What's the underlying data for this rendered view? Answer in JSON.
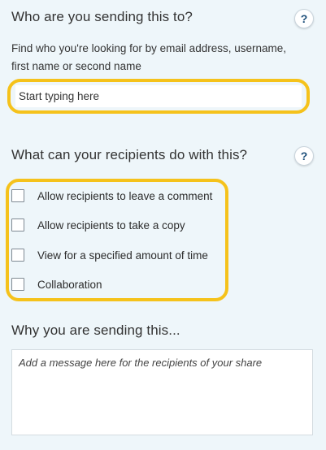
{
  "recipients": {
    "title": "Who are you sending this to?",
    "help_icon": "?",
    "hint": "Find who you're looking for by email address, username, first name or second name",
    "search_placeholder": "Start typing here",
    "search_value": ""
  },
  "permissions": {
    "title": "What can your recipients do with this?",
    "help_icon": "?",
    "options": [
      {
        "label": "Allow recipients to leave a comment",
        "checked": false
      },
      {
        "label": "Allow recipients to take a copy",
        "checked": false
      },
      {
        "label": "View for a specified amount of time",
        "checked": false
      },
      {
        "label": "Collaboration",
        "checked": false
      }
    ]
  },
  "reason": {
    "title": "Why you are sending this...",
    "message_placeholder": "Add a message here for the recipients of your share",
    "message_value": ""
  },
  "colors": {
    "background": "#eef6fa",
    "highlight": "#f5c21b",
    "help_icon_text": "#1d4f7a"
  }
}
